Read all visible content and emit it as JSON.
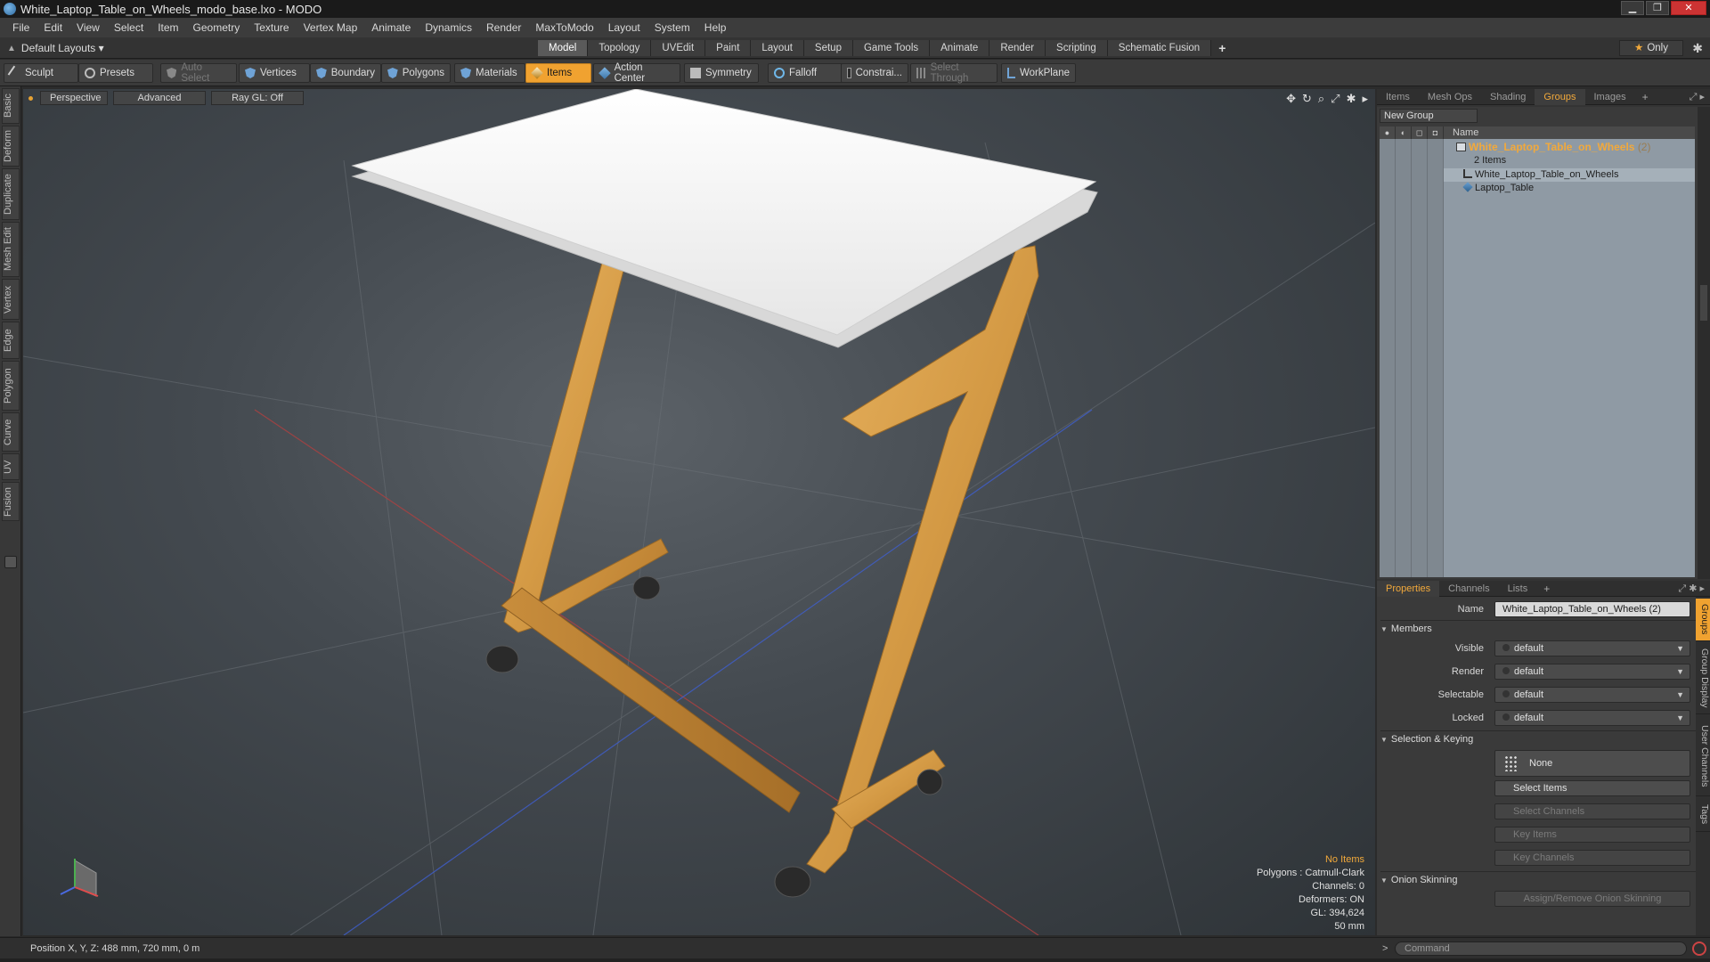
{
  "window": {
    "title": "White_Laptop_Table_on_Wheels_modo_base.lxo - MODO",
    "minimize": "▁",
    "maximize": "❐",
    "close": "✕"
  },
  "menu": [
    "File",
    "Edit",
    "View",
    "Select",
    "Item",
    "Geometry",
    "Texture",
    "Vertex Map",
    "Animate",
    "Dynamics",
    "Render",
    "MaxToModo",
    "Layout",
    "System",
    "Help"
  ],
  "layouts": {
    "dropdown": "Default Layouts ▾",
    "tabs": [
      "Model",
      "Topology",
      "UVEdit",
      "Paint",
      "Layout",
      "Setup",
      "Game Tools",
      "Animate",
      "Render",
      "Scripting",
      "Schematic Fusion"
    ],
    "active_tab": "Model",
    "add": "+",
    "only": "Only"
  },
  "toolbar": {
    "sculpt": "Sculpt",
    "presets": "Presets",
    "auto_select": "Auto Select",
    "vertices": "Vertices",
    "boundary": "Boundary",
    "polygons": "Polygons",
    "materials": "Materials",
    "items": "Items",
    "action_center": "Action Center",
    "symmetry": "Symmetry",
    "falloff": "Falloff",
    "constraints": "Constrai...",
    "select_through": "Select Through",
    "workplane": "WorkPlane"
  },
  "left_tabs": [
    "Basic",
    "Deform",
    "Duplicate",
    "Mesh Edit",
    "Vertex",
    "Edge",
    "Polygon",
    "Curve",
    "UV",
    "Fusion"
  ],
  "viewport": {
    "perspective": "Perspective",
    "advanced": "Advanced",
    "raygl": "Ray GL: Off",
    "info": {
      "selection": "No Items",
      "polygons": "Polygons : Catmull-Clark",
      "channels": "Channels: 0",
      "deformers": "Deformers: ON",
      "gl": "GL: 394,624",
      "scale": "50 mm"
    }
  },
  "groups_panel": {
    "tabs": [
      "Items",
      "Mesh Ops",
      "Shading",
      "Groups",
      "Images"
    ],
    "active_tab": "Groups",
    "new_group": "New Group",
    "name_col": "Name",
    "group_name": "White_Laptop_Table_on_Wheels",
    "group_count": "(2)",
    "items_count": "2 Items",
    "children": [
      "White_Laptop_Table_on_Wheels",
      "Laptop_Table"
    ]
  },
  "properties": {
    "tabs": [
      "Properties",
      "Channels",
      "Lists"
    ],
    "active_tab": "Properties",
    "name_label": "Name",
    "name_value": "White_Laptop_Table_on_Wheels (2)",
    "members_section": "Members",
    "visible_label": "Visible",
    "visible_value": "default",
    "render_label": "Render",
    "render_value": "default",
    "selectable_label": "Selectable",
    "selectable_value": "default",
    "locked_label": "Locked",
    "locked_value": "default",
    "selection_section": "Selection & Keying",
    "none_btn": "None",
    "select_items": "Select Items",
    "select_channels": "Select Channels",
    "key_items": "Key Items",
    "key_channels": "Key Channels",
    "onion_section": "Onion Skinning",
    "onion_btn": "Assign/Remove Onion Skinning",
    "side_tabs": [
      "Groups",
      "Group Display",
      "User Channels",
      "Tags"
    ]
  },
  "status": {
    "position": "Position X, Y, Z:  488 mm, 720 mm, 0 m"
  },
  "command": {
    "prompt": ">",
    "placeholder": "Command"
  },
  "colors": {
    "accent": "#f0a230",
    "wood": "#d9a04a",
    "tabletop": "#f2f2f2"
  }
}
